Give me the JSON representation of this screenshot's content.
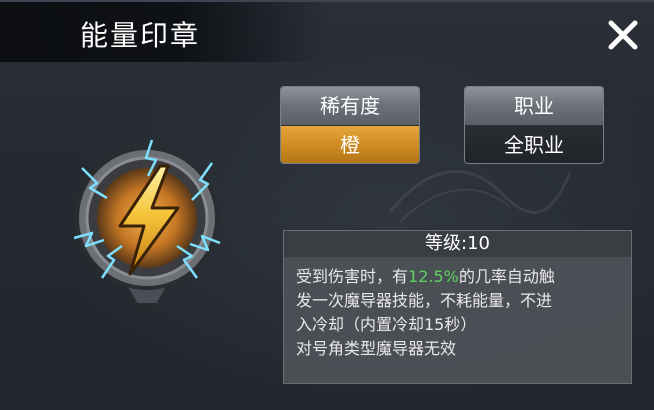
{
  "dialog": {
    "title": "能量印章",
    "close_icon": "close-icon"
  },
  "item": {
    "icon": "lightning-seal-icon",
    "rarity": {
      "label": "稀有度",
      "value": "橙",
      "color": "#d89428"
    },
    "profession": {
      "label": "职业",
      "value": "全职业"
    }
  },
  "description": {
    "level_label": "等级:10",
    "line1_before": "受到伤害时，有",
    "line1_highlight": "12.5%",
    "line1_after": "的几率自动触",
    "line2": "发一次魔导器技能，不耗能量，不进",
    "line3": "入冷却（内置冷却15秒）",
    "line4": "对号角类型魔导器无效",
    "highlight_color": "#5fd35f"
  }
}
